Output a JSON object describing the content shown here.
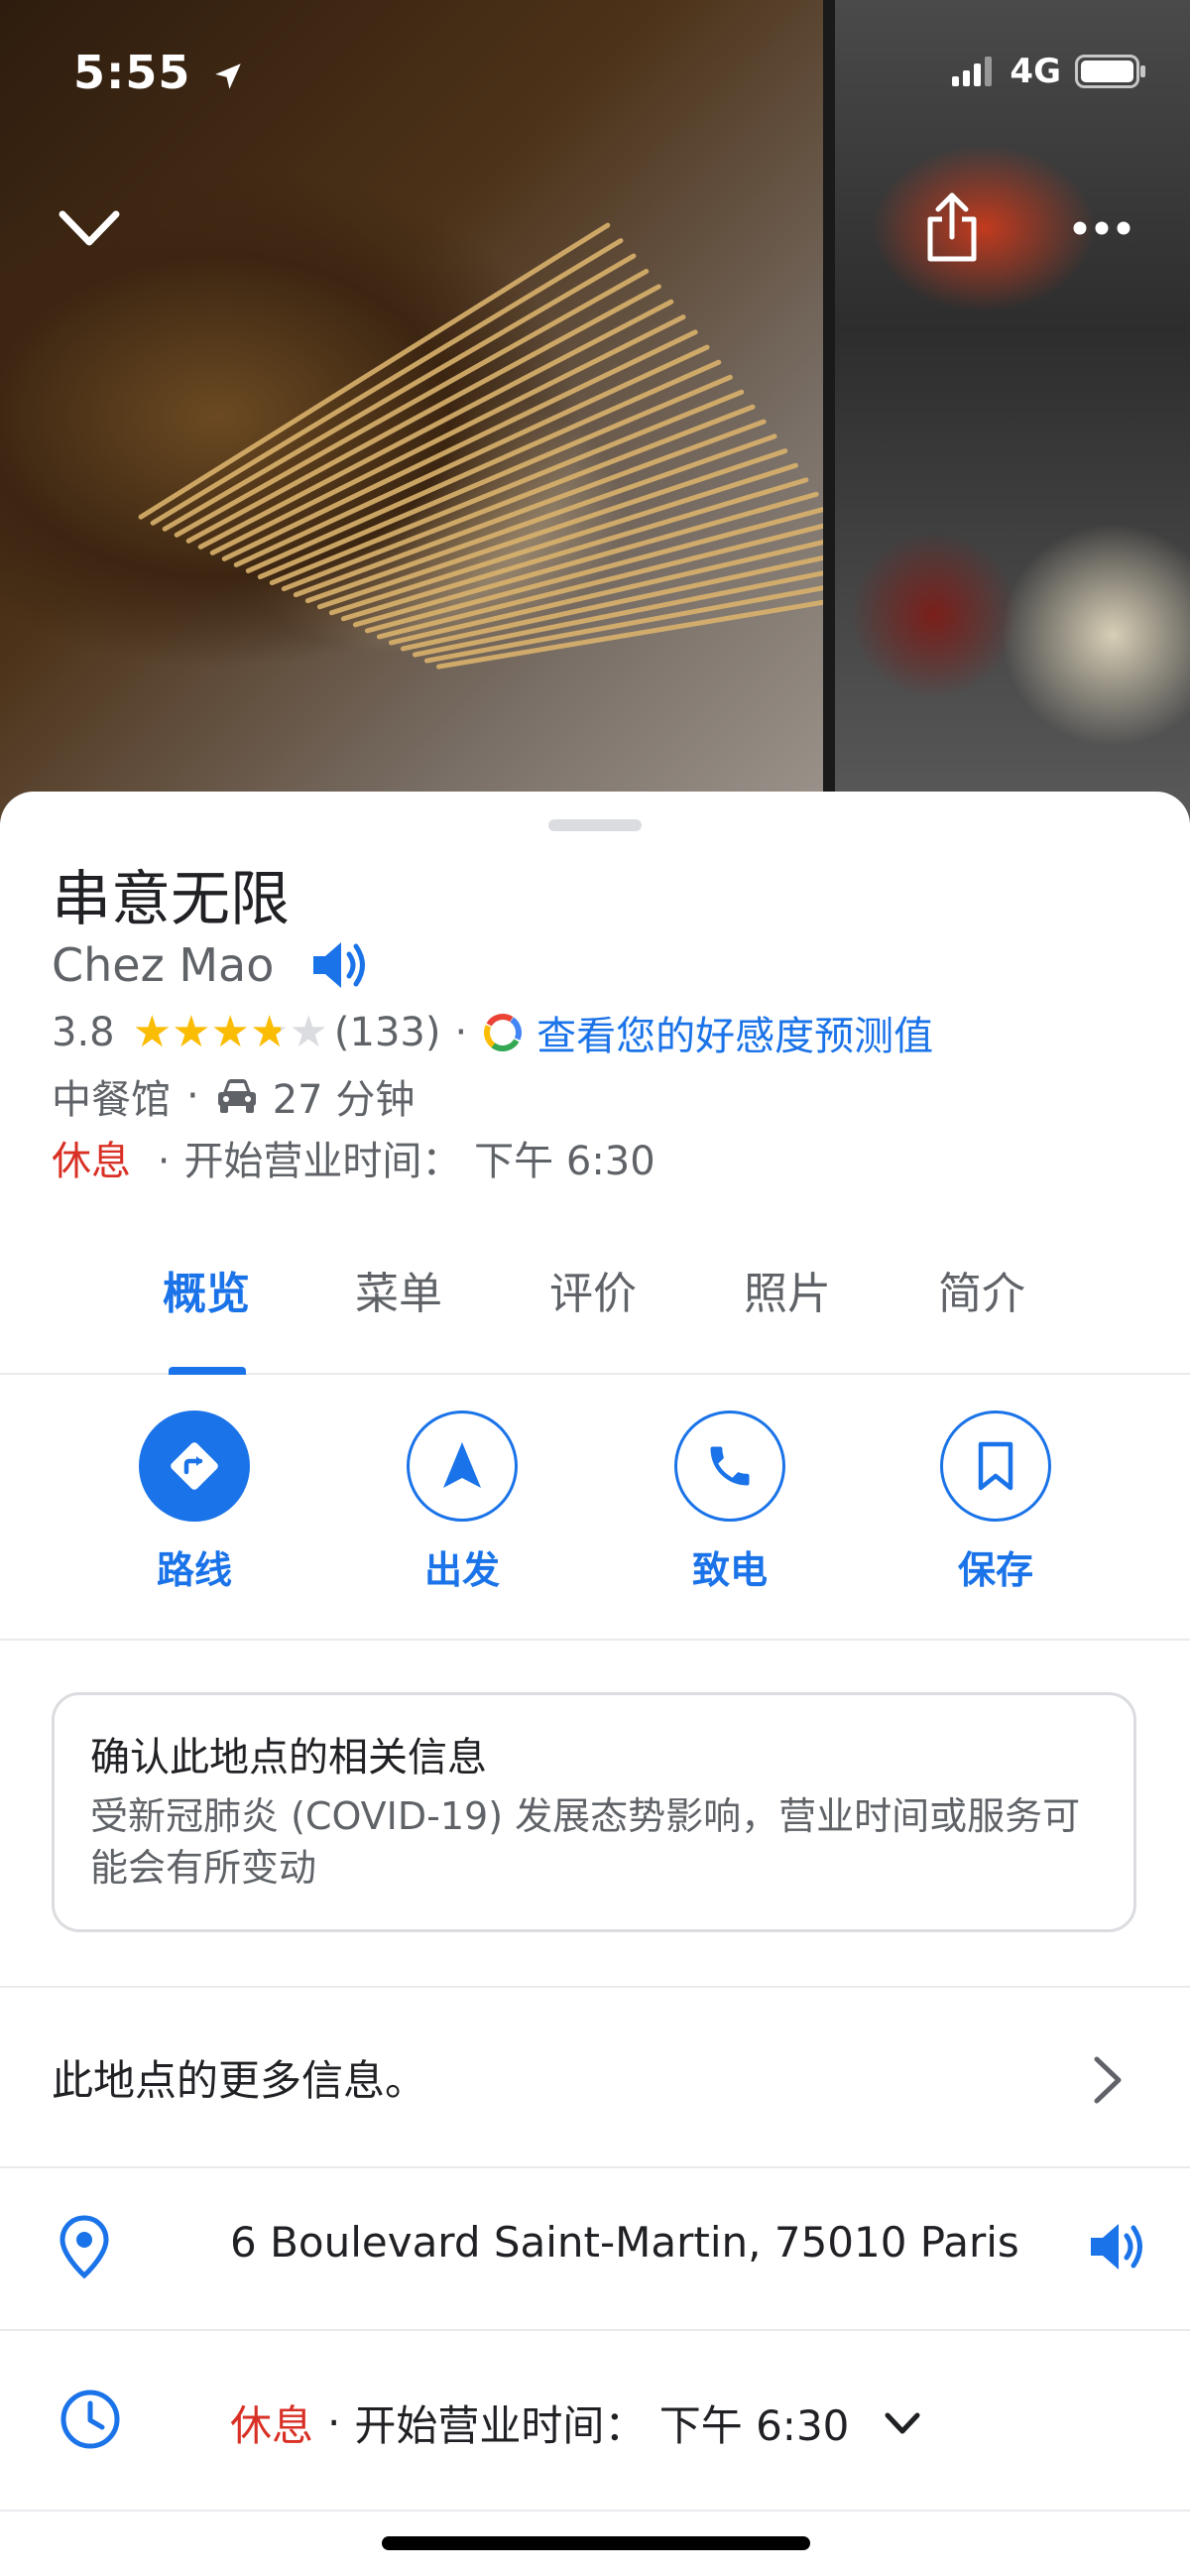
{
  "status_bar": {
    "time": "5:55",
    "network": "4G"
  },
  "place": {
    "name": "串意无限",
    "subtitle": "Chez Mao",
    "rating": "3.8",
    "rating_value": 3.8,
    "review_count": "(133)",
    "prediction_link": "查看您的好感度预测值",
    "category": "中餐馆",
    "drive_time": "27 分钟",
    "status": "休息",
    "open_info": "开始营业时间： 下午 6:30",
    "dot": "·"
  },
  "tabs": [
    {
      "label": "概览",
      "active": true
    },
    {
      "label": "菜单"
    },
    {
      "label": "评价"
    },
    {
      "label": "照片"
    },
    {
      "label": "简介"
    }
  ],
  "actions": [
    {
      "label": "路线",
      "icon": "directions-icon"
    },
    {
      "label": "出发",
      "icon": "navigation-icon"
    },
    {
      "label": "致电",
      "icon": "phone-icon"
    },
    {
      "label": "保存",
      "icon": "bookmark-icon"
    }
  ],
  "notice": {
    "title": "确认此地点的相关信息",
    "body": "受新冠肺炎 (COVID-19) 发展态势影响，营业时间或服务可能会有所变动"
  },
  "more_info": "此地点的更多信息。",
  "address": "6 Boulevard Saint-Martin, 75010 Paris",
  "hours": {
    "status": "休息",
    "detail": "开始营业时间： 下午 6:30"
  },
  "colors": {
    "accent": "#1a73e8",
    "closed": "#d93025",
    "star": "#fbbc04"
  }
}
